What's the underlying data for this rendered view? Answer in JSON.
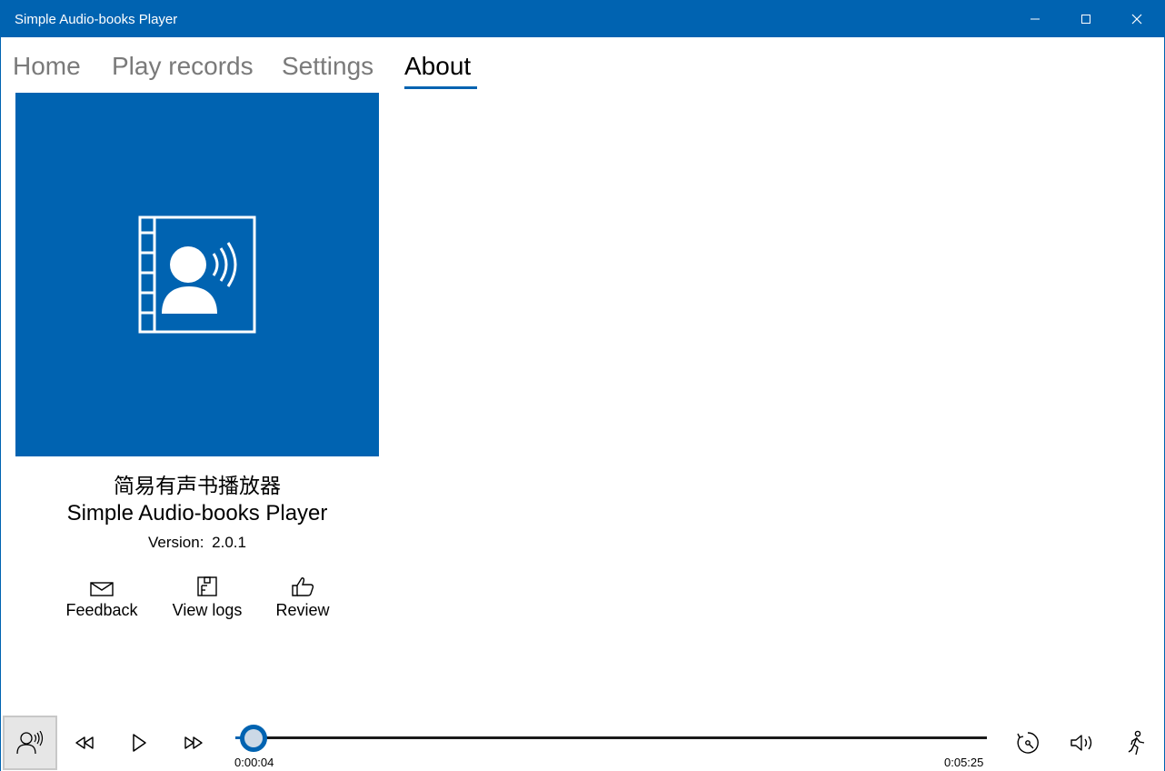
{
  "window": {
    "title": "Simple Audio-books Player",
    "accent_color": "#0063B1"
  },
  "tabs": [
    {
      "label": "Home",
      "active": false
    },
    {
      "label": "Play records",
      "active": false
    },
    {
      "label": "Settings",
      "active": false
    },
    {
      "label": "About",
      "active": true
    }
  ],
  "about": {
    "logo_icon": "audiobook-speaker-icon",
    "app_name_cn": "简易有声书播放器",
    "app_name_en": "Simple Audio-books Player",
    "version_label": "Version:",
    "version_value": "2.0.1",
    "actions": [
      {
        "label": "Feedback",
        "icon": "mail-icon"
      },
      {
        "label": "View logs",
        "icon": "logs-icon"
      },
      {
        "label": "Review",
        "icon": "thumbs-up-icon"
      }
    ]
  },
  "player": {
    "current_time": "0:00:04",
    "total_time": "0:05:25",
    "progress_fraction": 0.012,
    "icons": [
      "speaker-avatar-icon",
      "rewind-icon",
      "play-icon",
      "fast-forward-icon",
      "playback-speed-icon",
      "volume-icon",
      "walking-man-icon"
    ]
  }
}
